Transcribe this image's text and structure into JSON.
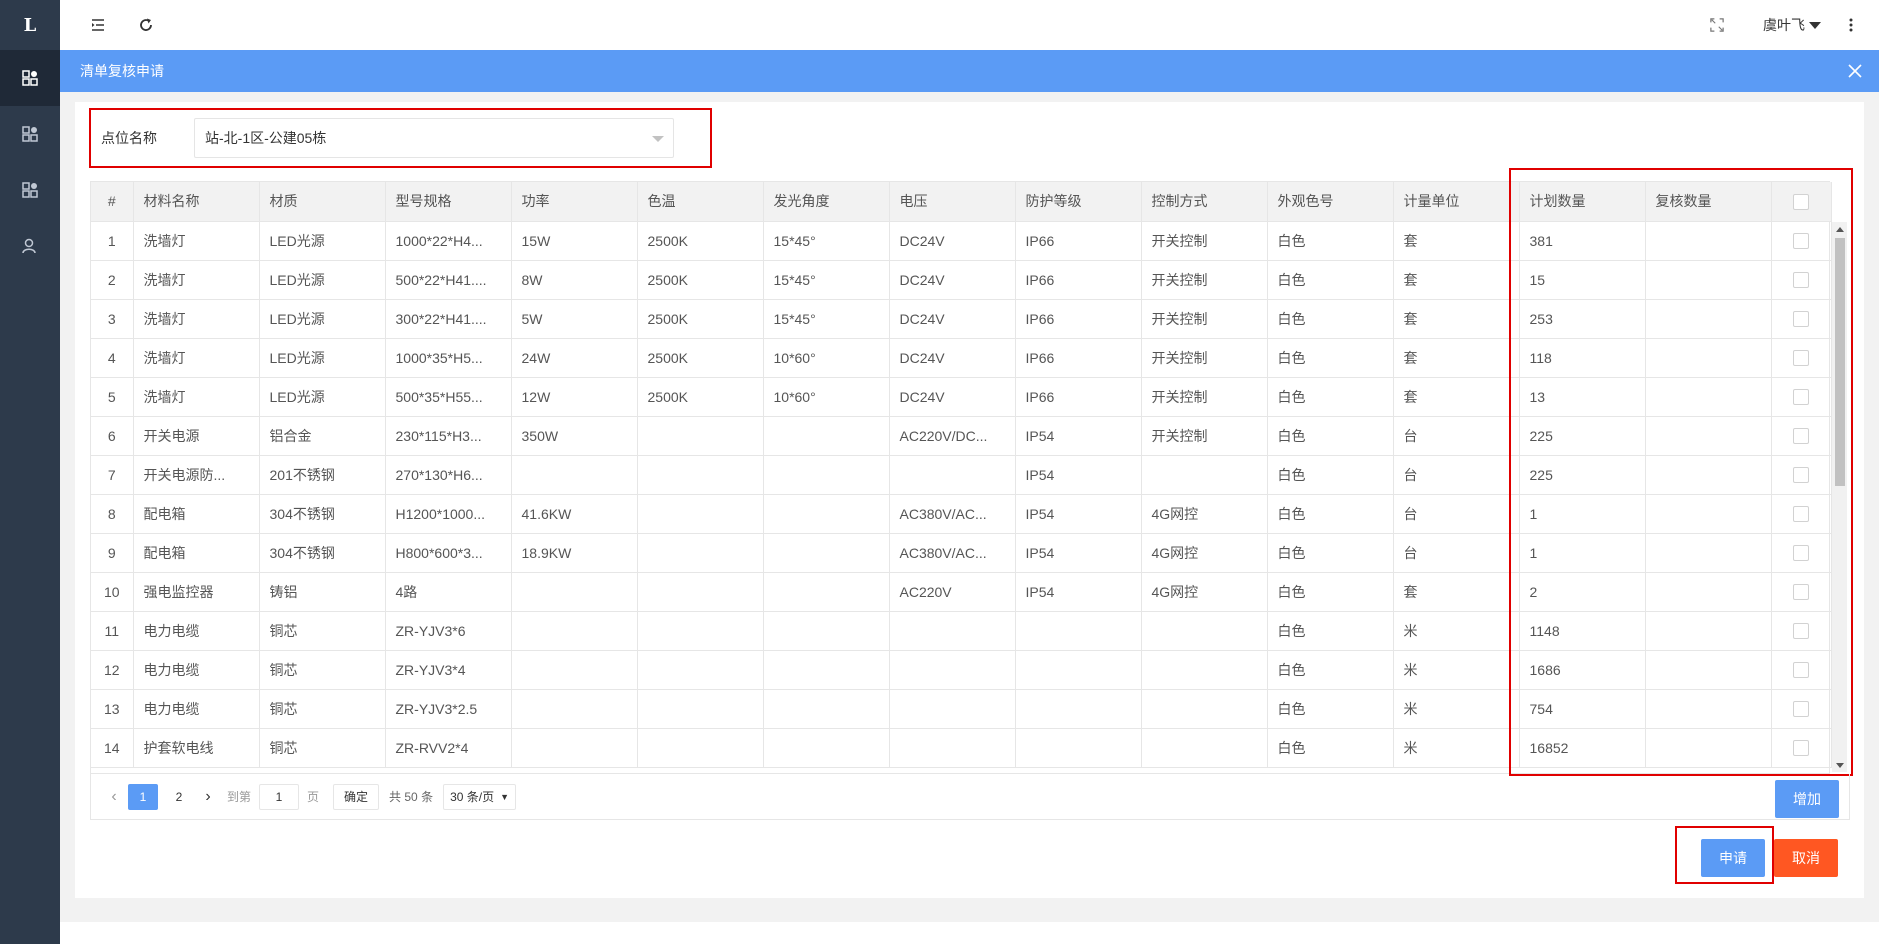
{
  "sidebar": {
    "logo": "L",
    "items": [
      {
        "icon": "dashboard-icon",
        "active": true
      },
      {
        "icon": "dashboard-icon",
        "active": false
      },
      {
        "icon": "dashboard-icon",
        "active": false
      },
      {
        "icon": "user-icon",
        "active": false
      }
    ]
  },
  "topbar": {
    "user_name": "虞叶飞"
  },
  "modal": {
    "title": "清单复核申请"
  },
  "filter": {
    "label": "点位名称",
    "value": "站-北-1区-公建05栋"
  },
  "table": {
    "columns": [
      "#",
      "材料名称",
      "材质",
      "型号规格",
      "功率",
      "色温",
      "发光角度",
      "电压",
      "防护等级",
      "控制方式",
      "外观色号",
      "计量单位",
      "计划数量",
      "复核数量"
    ],
    "rows": [
      [
        "1",
        "洗墙灯",
        "LED光源",
        "1000*22*H4...",
        "15W",
        "2500K",
        "15*45°",
        "DC24V",
        "IP66",
        "开关控制",
        "白色",
        "套",
        "381",
        ""
      ],
      [
        "2",
        "洗墙灯",
        "LED光源",
        "500*22*H41....",
        "8W",
        "2500K",
        "15*45°",
        "DC24V",
        "IP66",
        "开关控制",
        "白色",
        "套",
        "15",
        ""
      ],
      [
        "3",
        "洗墙灯",
        "LED光源",
        "300*22*H41....",
        "5W",
        "2500K",
        "15*45°",
        "DC24V",
        "IP66",
        "开关控制",
        "白色",
        "套",
        "253",
        ""
      ],
      [
        "4",
        "洗墙灯",
        "LED光源",
        "1000*35*H5...",
        "24W",
        "2500K",
        "10*60°",
        "DC24V",
        "IP66",
        "开关控制",
        "白色",
        "套",
        "118",
        ""
      ],
      [
        "5",
        "洗墙灯",
        "LED光源",
        "500*35*H55...",
        "12W",
        "2500K",
        "10*60°",
        "DC24V",
        "IP66",
        "开关控制",
        "白色",
        "套",
        "13",
        ""
      ],
      [
        "6",
        "开关电源",
        "铝合金",
        "230*115*H3...",
        "350W",
        "",
        "",
        "AC220V/DC...",
        "IP54",
        "开关控制",
        "白色",
        "台",
        "225",
        ""
      ],
      [
        "7",
        "开关电源防...",
        "201不锈钢",
        "270*130*H6...",
        "",
        "",
        "",
        "",
        "IP54",
        "",
        "白色",
        "台",
        "225",
        ""
      ],
      [
        "8",
        "配电箱",
        "304不锈钢",
        "H1200*1000...",
        "41.6KW",
        "",
        "",
        "AC380V/AC...",
        "IP54",
        "4G网控",
        "白色",
        "台",
        "1",
        ""
      ],
      [
        "9",
        "配电箱",
        "304不锈钢",
        "H800*600*3...",
        "18.9KW",
        "",
        "",
        "AC380V/AC...",
        "IP54",
        "4G网控",
        "白色",
        "台",
        "1",
        ""
      ],
      [
        "10",
        "强电监控器",
        "铸铝",
        "4路",
        "",
        "",
        "",
        "AC220V",
        "IP54",
        "4G网控",
        "白色",
        "套",
        "2",
        ""
      ],
      [
        "11",
        "电力电缆",
        "铜芯",
        "ZR-YJV3*6",
        "",
        "",
        "",
        "",
        "",
        "",
        "白色",
        "米",
        "1148",
        ""
      ],
      [
        "12",
        "电力电缆",
        "铜芯",
        "ZR-YJV3*4",
        "",
        "",
        "",
        "",
        "",
        "",
        "白色",
        "米",
        "1686",
        ""
      ],
      [
        "13",
        "电力电缆",
        "铜芯",
        "ZR-YJV3*2.5",
        "",
        "",
        "",
        "",
        "",
        "",
        "白色",
        "米",
        "754",
        ""
      ],
      [
        "14",
        "护套软电线",
        "铜芯",
        "ZR-RVV2*4",
        "",
        "",
        "",
        "",
        "",
        "",
        "白色",
        "米",
        "16852",
        ""
      ]
    ]
  },
  "pager": {
    "pages": [
      "1",
      "2"
    ],
    "current": "1",
    "goto_label": "到第",
    "goto_value": "1",
    "page_unit": "页",
    "confirm_label": "确定",
    "total_label": "共 50 条",
    "page_size": "30 条/页"
  },
  "buttons": {
    "add": "增加",
    "submit": "申请",
    "cancel": "取消"
  },
  "colors": {
    "primary": "#5b9bf5",
    "danger": "#ff5722",
    "sidebar": "#2d3a4b",
    "highlight": "#e00000"
  }
}
